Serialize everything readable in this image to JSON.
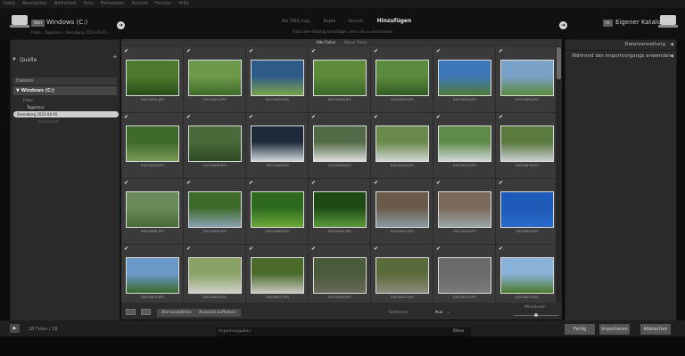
{
  "menubar": [
    "Datei",
    "Bearbeiten",
    "Bibliothek",
    "Foto",
    "Metadaten",
    "Ansicht",
    "Fenster",
    "Hilfe"
  ],
  "header": {
    "source_badge": "Von",
    "source_title": "Windows (C:)",
    "source_path": "Fotos › Tagestour › Demoberg 2023-06-05 ›",
    "modes": [
      "Als DNG kop.",
      "Kopie",
      "Versch.",
      "Hinzufügen"
    ],
    "active_mode_index": 3,
    "mode_subtitle": "Fotos dem Katalog hinzufügen, ohne sie zu verschieben",
    "dest_badge": "In",
    "dest_title": "Eigener Katalog"
  },
  "left_panel": {
    "title": "Quelle",
    "section": "Dateien",
    "volume": "Windows (C:)",
    "tree": [
      "Fotos",
      "Tagestour",
      "Demoberg 2023-06-05",
      "Unterordner"
    ],
    "selected_index": 2
  },
  "filterbar": {
    "tabs": [
      "Alle Fotos",
      "Neue Fotos"
    ],
    "active": 0
  },
  "photos": [
    {
      "name": "DSC04451.JPG",
      "c1": "#4d7a2c",
      "c2": "#2a4d1c"
    },
    {
      "name": "DSC04452.JPG",
      "c1": "#6d9a4a",
      "c2": "#3e6a2a"
    },
    {
      "name": "DSC04455.JPG",
      "c1": "#2e5a88",
      "c2": "#7aa34c"
    },
    {
      "name": "DSC04458.JPG",
      "c1": "#5e8a3a",
      "c2": "#3a6628"
    },
    {
      "name": "DSC04459.JPG",
      "c1": "#5b8b3e",
      "c2": "#355d24"
    },
    {
      "name": "DSC04460.JPG",
      "c1": "#3f78b8",
      "c2": "#4c7a3a"
    },
    {
      "name": "DSC04462.JPG",
      "c1": "#7aa2c8",
      "c2": "#5b8a3c"
    },
    {
      "name": "DSC04464.JPG",
      "c1": "#3e6a2a",
      "c2": "#7a9a56"
    },
    {
      "name": "DSC04465.JPG",
      "c1": "#4a6a3a",
      "c2": "#2e4a24"
    },
    {
      "name": "DSC04466.JPG",
      "c1": "#1e2a3a",
      "c2": "#cfd6da"
    },
    {
      "name": "DSC04468.JPG",
      "c1": "#526a46",
      "c2": "#dcdcdc"
    },
    {
      "name": "DSC04469.JPG",
      "c1": "#6a8a4c",
      "c2": "#d0d4d0"
    },
    {
      "name": "DSC04470.JPG",
      "c1": "#5e8a4a",
      "c2": "#cfd8d8"
    },
    {
      "name": "DSC04476.JPG",
      "c1": "#5a7a3e",
      "c2": "#c8ccd0"
    },
    {
      "name": "DSC04481.JPG",
      "c1": "#6b8a5a",
      "c2": "#4a6a3a"
    },
    {
      "name": "DSC04485.JPG",
      "c1": "#3e6a2a",
      "c2": "#8aa2b2"
    },
    {
      "name": "DSC04488.JPG",
      "c1": "#2e6a1e",
      "c2": "#6aa83a"
    },
    {
      "name": "DSC04491.JPG",
      "c1": "#1e4a14",
      "c2": "#5a9a3a"
    },
    {
      "name": "DSC04492.JPG",
      "c1": "#6a5a4a",
      "c2": "#8a9aa2"
    },
    {
      "name": "DSC04494.JPG",
      "c1": "#7a6a5a",
      "c2": "#9aa6a8"
    },
    {
      "name": "DSC04500.JPG",
      "c1": "#1e5ab8",
      "c2": "#2a6ac8"
    },
    {
      "name": "DSC04502.JPG",
      "c1": "#6a9ac8",
      "c2": "#3a6a2a"
    },
    {
      "name": "DSC04504.JPG",
      "c1": "#8aa266",
      "c2": "#cfd0c8"
    },
    {
      "name": "DSC04507.JPG",
      "c1": "#4a6a2a",
      "c2": "#c8c8c0"
    },
    {
      "name": "DSC04509.JPG",
      "c1": "#4a5a3a",
      "c2": "#6a6a5a"
    },
    {
      "name": "DSC04510.JPG",
      "c1": "#5a6a3a",
      "c2": "#8a8a7a"
    },
    {
      "name": "DSC04512.JPG",
      "c1": "#6a6a6a",
      "c2": "#7a7a78"
    },
    {
      "name": "DSC04515.JPG",
      "c1": "#8ab2d8",
      "c2": "#4a7a2a"
    }
  ],
  "toolbar": {
    "btn_check_all": "Alle auswählen",
    "btn_uncheck_all": "Auswahl aufheben",
    "sort_label": "Sortieren:",
    "sort_value": "Aus",
    "thumb_label": "Miniaturen"
  },
  "right_panel": {
    "row1": "Dateiverwaltung",
    "row2": "Während des Importvorgangs anwenden"
  },
  "bottom": {
    "photo_count": "28 Fotos / 28",
    "preset_label": "Importvorgaben",
    "preset_value": "Ohne",
    "btn_done": "Fertig",
    "btn_import": "Importieren",
    "btn_cancel": "Abbrechen"
  },
  "colors": {
    "accent": "#d9d9d9",
    "panel": "#2a2a2a",
    "grid": "#2e2e2e"
  }
}
